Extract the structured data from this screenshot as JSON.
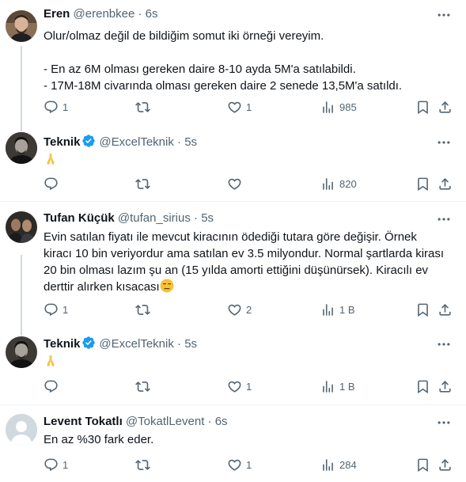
{
  "tweets": [
    {
      "name": "Eren",
      "handle": "@erenbkee",
      "dot": "·",
      "time": "6s",
      "verified": false,
      "lines": [
        "Olur/olmaz değil de bildiğim somut iki örneği vereyim.",
        "",
        "- En az 6M olması gereken daire 8-10 ayda 5M'a satılabildi.",
        "- 17M-18M civarında olması gereken daire 2 senede 13,5M'a satıldı."
      ],
      "replies": "1",
      "retweets": "",
      "likes": "1",
      "views": "985"
    },
    {
      "name": "Teknik",
      "handle": "@ExcelTeknik",
      "dot": "·",
      "time": "5s",
      "verified": true,
      "emoji": "folded-hands",
      "replies": "",
      "retweets": "",
      "likes": "",
      "views": "820"
    },
    {
      "name": "Tufan Küçük",
      "handle": "@tufan_sirius",
      "dot": "·",
      "time": "5s",
      "verified": false,
      "lines": [
        "Evin satılan fiyatı ile mevcut kiracının ödediği tutara göre değişir. Örnek",
        "kiracı 10 bin veriyordur ama satılan ev 3.5 milyondur. Normal şartlarda kirası",
        "20 bin olması lazım şu an (15 yılda amorti ettiğini düşünürsek). Kiracılı ev",
        "derttir alırken kısacası"
      ],
      "trailing_emoji": "expressionless-face",
      "replies": "1",
      "retweets": "",
      "likes": "2",
      "views": "1 B"
    },
    {
      "name": "Teknik",
      "handle": "@ExcelTeknik",
      "dot": "·",
      "time": "5s",
      "verified": true,
      "emoji": "folded-hands",
      "replies": "",
      "retweets": "",
      "likes": "1",
      "views": "1 B"
    },
    {
      "name": "Levent Tokatlı",
      "handle": "@TokatlLevent",
      "dot": "·",
      "time": "6s",
      "verified": false,
      "lines": [
        "En az %30 fark eder."
      ],
      "replies": "1",
      "retweets": "",
      "likes": "1",
      "views": "284"
    }
  ],
  "colors": {
    "verified": "#1d9bf0",
    "text": "#0f1419",
    "muted": "#536471",
    "thread_line": "#cfd9de"
  }
}
